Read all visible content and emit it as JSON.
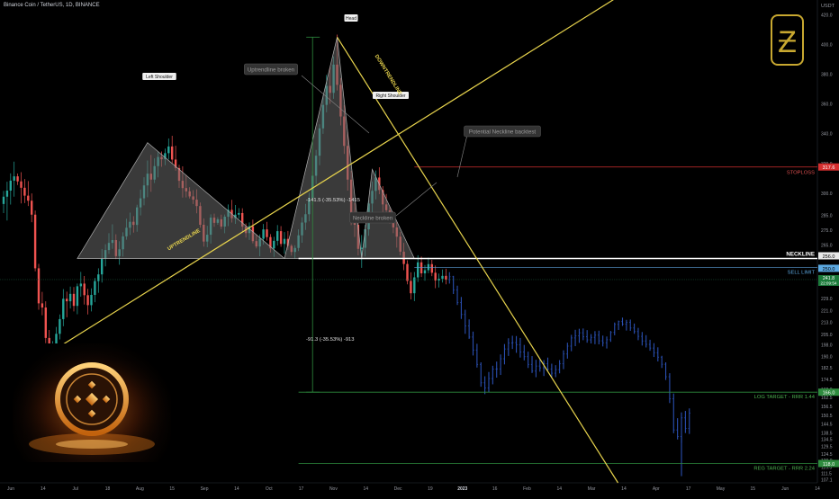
{
  "header": {
    "symbol_title": "Binance Coin / TetherUS, 1D, BINANCE"
  },
  "colors": {
    "up": "#26a69a",
    "down": "#ef5350",
    "projection": "#2a4fb0",
    "pattern_line": "#e8d44d",
    "green_line": "#2e8b3e",
    "stop_line": "#d32f2f",
    "neckline": "#ffffff",
    "shape_fill": "#6a6a6a",
    "label_bg": "#333333",
    "label_fg": "#9a9a9a",
    "logo": "#c8a830"
  },
  "logo": {
    "letter": "Ƶ",
    "icon": "stylized-b-logo-icon"
  },
  "photo": {
    "icon": "bnb-coin-icon"
  },
  "labels": {
    "head": "Head",
    "left_shoulder": "Left Shoulder",
    "right_shoulder": "Right Shoulder",
    "uptrend_broken": "Uptrendline broken",
    "potential_backtest": "Potential Neckline backtest",
    "neckline_broken": "Neckline broken",
    "uptrendline": "UPTRENDLINE",
    "downtrendline": "DOWNTRENDLINE",
    "neckline": "NECKLINE",
    "stoploss": "STOPLOSS",
    "sell_limit": "SELL LIMIT",
    "log_target": "LOG TARGET - RRR 1.44",
    "reg_target": "REG TARGET - RRR 2.24",
    "measure_top": "-141.5 (-35.53%) -1415",
    "measure_bottom": "-91.3 (-35.53%) -913"
  },
  "price_tags": {
    "stop": "317.6",
    "neck_top": "256.0",
    "neck_bottom": "250.0",
    "current": "241.8",
    "countdown": "22:09:54",
    "log": "166.0",
    "reg": "118.0"
  },
  "chart_data": {
    "type": "candlestick",
    "y_unit": "USDT",
    "ylim": [
      105,
      430
    ],
    "x_tick_labels": [
      "Jun",
      "14",
      "Jul",
      "18",
      "Aug",
      "15",
      "Sep",
      "14",
      "Oct",
      "17",
      "Nov",
      "14",
      "Dec",
      "19",
      "2023",
      "16",
      "Feb",
      "14",
      "Mar",
      "14",
      "Apr",
      "17",
      "May",
      "15",
      "Jun",
      "14"
    ],
    "y_tick_labels": [
      "420.0",
      "400.0",
      "380.0",
      "360.0",
      "340.0",
      "320.0",
      "300.0",
      "285.0",
      "275.0",
      "265.0",
      "250.0",
      "240.0",
      "229.0",
      "221.0",
      "213.0",
      "205.0",
      "198.0",
      "190.0",
      "182.5",
      "174.5",
      "168.0",
      "162.5",
      "156.5",
      "150.5",
      "144.5",
      "138.5",
      "134.5",
      "129.5",
      "124.5",
      "120.0",
      "115.5",
      "111.5",
      "107.1"
    ],
    "levels": {
      "stoploss": 317.6,
      "neckline": 256.0,
      "neckline_lower": 250.0,
      "current_price": 241.8,
      "log_target": 166.0,
      "reg_target": 118.0,
      "head": 405.0
    },
    "pattern": {
      "left_shoulder": {
        "start": [
          21,
          256
        ],
        "peak": [
          41,
          334
        ],
        "end": [
          80,
          256
        ]
      },
      "head": {
        "start": [
          80,
          256
        ],
        "peak": [
          95,
          405
        ],
        "end": [
          102,
          256
        ]
      },
      "right_shoulder": {
        "start": [
          102,
          256
        ],
        "peak": [
          105,
          316
        ],
        "end": [
          117,
          256
        ]
      }
    },
    "trendlines": {
      "uptrend": {
        "from": [
          7,
          183.5
        ],
        "to": [
          183,
          444
        ]
      },
      "downtrend": {
        "from": [
          95,
          405
        ],
        "to": [
          175,
          105
        ]
      }
    },
    "measure": {
      "x": 88,
      "top": [
        405,
        256
      ],
      "bottom": [
        256,
        166
      ]
    },
    "candles_history": [
      [
        292.7,
        301.5,
        286.6,
        297.6
      ],
      [
        297.6,
        307.7,
        281.6,
        301.7
      ],
      [
        301.7,
        313.3,
        292.3,
        308.4
      ],
      [
        308.4,
        321.2,
        297.6,
        311.3
      ],
      [
        311.3,
        313.2,
        305.5,
        307.9
      ],
      [
        307.9,
        314.1,
        293.1,
        303.6
      ],
      [
        303.6,
        309.5,
        293.3,
        298.3
      ],
      [
        298.3,
        308.1,
        291.3,
        294.9
      ],
      [
        294.9,
        299.8,
        280.4,
        285.5
      ],
      [
        285.5,
        288.3,
        247.4,
        249.4
      ],
      [
        249.4,
        252.4,
        221.5,
        225.8
      ],
      [
        225.8,
        233.5,
        217.8,
        223.0
      ],
      [
        223.0,
        227.2,
        199.0,
        202.5
      ],
      [
        202.5,
        207.9,
        180.7,
        186.5
      ],
      [
        186.5,
        200.4,
        183.8,
        193.9
      ],
      [
        193.9,
        209.9,
        190.2,
        205.3
      ],
      [
        205.3,
        218.3,
        201.5,
        215.2
      ],
      [
        215.2,
        235.4,
        210.4,
        228.9
      ],
      [
        228.9,
        233.7,
        216.4,
        227.2
      ],
      [
        227.2,
        237.1,
        222.3,
        232.2
      ],
      [
        232.2,
        236.8,
        220.4,
        224.1
      ],
      [
        224.1,
        239.1,
        218.5,
        237.3
      ],
      [
        237.3,
        247.0,
        230.3,
        239.1
      ],
      [
        239.1,
        244.2,
        225.0,
        231.3
      ],
      [
        231.3,
        235.6,
        218.3,
        224.6
      ],
      [
        224.6,
        235.9,
        220.4,
        231.5
      ],
      [
        231.5,
        242.9,
        226.6,
        240.8
      ],
      [
        240.8,
        249.4,
        232.9,
        245.3
      ],
      [
        245.3,
        262.4,
        239.8,
        255.9
      ],
      [
        255.9,
        265.6,
        250.7,
        261.7
      ],
      [
        261.7,
        273.0,
        259.1,
        266.5
      ],
      [
        266.5,
        279.0,
        262.5,
        268.4
      ],
      [
        268.4,
        272.3,
        255.6,
        257.6
      ],
      [
        257.6,
        267.6,
        251.8,
        262.2
      ],
      [
        262.2,
        273.6,
        257.4,
        270.9
      ],
      [
        270.9,
        282.8,
        268.6,
        276.7
      ],
      [
        276.7,
        286.9,
        271.8,
        280.7
      ],
      [
        280.7,
        284.5,
        273.4,
        278.6
      ],
      [
        278.6,
        292.2,
        274.0,
        290.4
      ],
      [
        290.4,
        302.4,
        285.0,
        296.5
      ],
      [
        296.5,
        310.7,
        291.8,
        305.2
      ],
      [
        305.2,
        322.0,
        297.2,
        313.1
      ],
      [
        313.1,
        325.7,
        300.9,
        309.1
      ],
      [
        309.1,
        323.4,
        306.8,
        318.2
      ],
      [
        318.2,
        327.6,
        310.6,
        324.3
      ],
      [
        324.3,
        328.0,
        317.7,
        322.8
      ],
      [
        322.8,
        330.0,
        318.8,
        326.9
      ],
      [
        326.9,
        336.8,
        322.7,
        331.4
      ],
      [
        331.4,
        338.6,
        319.6,
        322.6
      ],
      [
        322.6,
        331.9,
        315.1,
        316.9
      ],
      [
        316.9,
        319.1,
        303.5,
        308.3
      ],
      [
        308.3,
        318.0,
        297.0,
        303.4
      ],
      [
        303.4,
        312.2,
        297.1,
        301.2
      ],
      [
        301.2,
        304.0,
        296.4,
        297.8
      ],
      [
        297.8,
        302.0,
        292.7,
        295.6
      ],
      [
        295.6,
        302.5,
        286.4,
        291.3
      ],
      [
        291.3,
        293.7,
        276.7,
        278.7
      ],
      [
        278.7,
        283.0,
        264.0,
        267.4
      ],
      [
        267.4,
        278.0,
        263.6,
        272.0
      ],
      [
        272.0,
        285.7,
        266.1,
        283.5
      ],
      [
        283.5,
        286.2,
        277.3,
        280.0
      ],
      [
        280.0,
        283.8,
        278.7,
        282.4
      ],
      [
        282.4,
        285.5,
        275.8,
        277.5
      ],
      [
        277.5,
        285.6,
        273.0,
        284.1
      ],
      [
        284.1,
        292.4,
        277.8,
        288.7
      ],
      [
        288.7,
        295.5,
        280.2,
        283.1
      ],
      [
        283.1,
        292.0,
        279.3,
        285.5
      ],
      [
        285.5,
        289.9,
        282.8,
        286.6
      ],
      [
        286.6,
        289.8,
        273.4,
        277.5
      ],
      [
        277.5,
        279.6,
        270.1,
        273.1
      ],
      [
        273.1,
        280.3,
        268.5,
        277.7
      ],
      [
        277.7,
        282.2,
        266.2,
        267.7
      ],
      [
        267.7,
        272.1,
        262.8,
        264.1
      ],
      [
        264.1,
        272.2,
        257.5,
        269.3
      ],
      [
        269.3,
        279.2,
        265.4,
        275.6
      ],
      [
        275.6,
        280.7,
        268.0,
        270.4
      ],
      [
        270.4,
        272.4,
        260.0,
        262.8
      ],
      [
        262.8,
        270.6,
        257.1,
        267.9
      ],
      [
        267.9,
        278.5,
        264.7,
        274.4
      ],
      [
        274.4,
        277.8,
        263.9,
        265.8
      ],
      [
        265.8,
        273.8,
        259.2,
        269.2
      ],
      [
        269.2,
        274.5,
        261.9,
        264.5
      ],
      [
        264.5,
        265.6,
        258.0,
        260.4
      ],
      [
        260.4,
        264.9,
        255.8,
        263.1
      ],
      [
        263.1,
        275.6,
        261.0,
        271.6
      ],
      [
        271.6,
        283.8,
        266.6,
        280.2
      ],
      [
        280.2,
        292.8,
        275.2,
        285.8
      ],
      [
        285.8,
        300.3,
        281.0,
        296.7
      ],
      [
        296.7,
        314.8,
        291.9,
        311.7
      ],
      [
        311.7,
        329.1,
        306.2,
        325.2
      ],
      [
        325.2,
        346.3,
        318.8,
        343.6
      ],
      [
        343.6,
        365.8,
        339.9,
        359.4
      ],
      [
        359.4,
        379.6,
        354.4,
        372.2
      ],
      [
        372.2,
        384.8,
        360.1,
        367.5
      ],
      [
        367.5,
        392.0,
        363.5,
        386.5
      ],
      [
        386.5,
        406.7,
        369.1,
        372.9
      ],
      [
        372.9,
        377.4,
        345.6,
        351.6
      ],
      [
        351.6,
        359.1,
        326.4,
        331.8
      ],
      [
        331.8,
        341.1,
        301.7,
        309.1
      ],
      [
        309.1,
        315.0,
        278.5,
        285.3
      ],
      [
        285.3,
        293.3,
        270.5,
        278.7
      ],
      [
        278.7,
        285.4,
        258.1,
        262.5
      ],
      [
        262.5,
        271.8,
        249.7,
        263.2
      ],
      [
        263.2,
        278.6,
        257.4,
        275.6
      ],
      [
        275.6,
        295.1,
        271.3,
        293.0
      ],
      [
        293.0,
        307.8,
        285.4,
        301.5
      ],
      [
        301.5,
        315.2,
        295.8,
        310.5
      ],
      [
        310.5,
        317.4,
        299.3,
        302.1
      ],
      [
        302.1,
        304.7,
        287.3,
        292.4
      ],
      [
        292.4,
        299.4,
        285.4,
        288.5
      ],
      [
        288.5,
        290.6,
        279.5,
        283.4
      ],
      [
        283.4,
        287.5,
        273.1,
        276.9
      ],
      [
        276.9,
        280.8,
        263.3,
        270.7
      ],
      [
        270.7,
        273.9,
        258.1,
        260.6
      ],
      [
        260.6,
        266.5,
        248.1,
        252.3
      ],
      [
        252.3,
        254.8,
        238.6,
        240.9
      ],
      [
        240.9,
        246.7,
        228.5,
        232.6
      ],
      [
        232.6,
        246.9,
        227.3,
        243.3
      ],
      [
        243.3,
        258.2,
        240.2,
        253.4
      ],
      [
        253.4,
        257.3,
        243.5,
        246.0
      ],
      [
        246.0,
        251.6,
        241.0,
        248.1
      ],
      [
        248.1,
        256.6,
        246.1,
        252.2
      ],
      [
        252.2,
        255.1,
        244.1,
        246.4
      ],
      [
        246.4,
        251.3,
        236.0,
        241.2
      ],
      [
        241.2,
        245.9,
        236.5,
        242.4
      ],
      [
        242.4,
        248.6,
        239.8,
        244.3
      ],
      [
        244.3,
        249.1,
        238.6,
        241.8
      ]
    ],
    "projection": [
      [
        241.8,
        246.8,
        239.1,
        243.7
      ],
      [
        243.7,
        244.3,
        232.1,
        234.8
      ],
      [
        234.8,
        237.7,
        224.7,
        226.3
      ],
      [
        226.3,
        230.1,
        215.3,
        218.3
      ],
      [
        218.3,
        221.5,
        205.3,
        210.6
      ],
      [
        210.6,
        215.0,
        201.9,
        203.1
      ],
      [
        203.1,
        206.8,
        190.7,
        194.4
      ],
      [
        194.4,
        198.6,
        182.6,
        184.7
      ],
      [
        184.7,
        186.1,
        169.7,
        172.3
      ],
      [
        172.3,
        176.7,
        164.7,
        168.9
      ],
      [
        168.9,
        179.6,
        165.8,
        175.2
      ],
      [
        175.2,
        183.8,
        171.3,
        181.5
      ],
      [
        181.5,
        186.6,
        175.8,
        181.7
      ],
      [
        181.7,
        191.4,
        177.6,
        188.5
      ],
      [
        188.5,
        198.4,
        184.7,
        195.1
      ],
      [
        195.1,
        202.3,
        190.4,
        199.2
      ],
      [
        199.2,
        204.0,
        195.1,
        199.4
      ],
      [
        199.4,
        203.8,
        192.5,
        198.0
      ],
      [
        198.0,
        202.5,
        189.3,
        193.1
      ],
      [
        193.1,
        197.8,
        187.4,
        189.9
      ],
      [
        189.9,
        193.3,
        182.3,
        184.7
      ],
      [
        184.7,
        190.3,
        178.9,
        180.2
      ],
      [
        180.2,
        187.8,
        176.1,
        183.6
      ],
      [
        183.6,
        188.0,
        179.8,
        182.4
      ],
      [
        182.4,
        187.6,
        176.9,
        185.1
      ],
      [
        185.1,
        189.3,
        180.3,
        181.6
      ],
      [
        181.6,
        185.2,
        175.6,
        178.8
      ],
      [
        178.8,
        184.2,
        176.1,
        181.2
      ],
      [
        181.2,
        187.6,
        178.7,
        185.1
      ],
      [
        185.1,
        194.2,
        181.5,
        191.7
      ],
      [
        191.7,
        199.3,
        188.6,
        197.0
      ],
      [
        197.0,
        204.6,
        193.6,
        202.5
      ],
      [
        202.5,
        208.0,
        197.0,
        204.0
      ],
      [
        204.0,
        208.7,
        199.2,
        206.0
      ],
      [
        206.0,
        208.9,
        201.0,
        203.3
      ],
      [
        203.3,
        207.8,
        199.3,
        201.2
      ],
      [
        201.2,
        205.1,
        198.8,
        202.9
      ],
      [
        202.9,
        207.1,
        198.3,
        204.4
      ],
      [
        204.4,
        207.4,
        198.2,
        200.6
      ],
      [
        200.6,
        204.1,
        196.8,
        199.3
      ],
      [
        199.3,
        203.5,
        195.4,
        201.3
      ],
      [
        201.3,
        207.2,
        199.9,
        206.2
      ],
      [
        206.2,
        212.9,
        204.3,
        211.6
      ],
      [
        211.6,
        214.2,
        207.9,
        213.5
      ],
      [
        213.5,
        216.2,
        210.6,
        211.9
      ],
      [
        211.9,
        214.7,
        207.5,
        213.1
      ],
      [
        213.1,
        214.9,
        207.3,
        209.2
      ],
      [
        209.2,
        212.2,
        205.3,
        206.8
      ],
      [
        206.8,
        209.3,
        201.0,
        203.6
      ],
      [
        203.6,
        206.5,
        197.4,
        200.5
      ],
      [
        200.5,
        204.4,
        196.1,
        198.2
      ],
      [
        198.2,
        201.3,
        193.9,
        195.7
      ],
      [
        195.7,
        199.0,
        189.7,
        192.6
      ],
      [
        192.6,
        196.2,
        186.7,
        189.6
      ],
      [
        189.6,
        190.5,
        182.3,
        184.8
      ],
      [
        184.8,
        186.1,
        174.2,
        176.4
      ],
      [
        176.4,
        178.8,
        158.7,
        161.5
      ],
      [
        161.5,
        165.1,
        138.4,
        140.6
      ],
      [
        140.6,
        148.5,
        134.2,
        136.1
      ],
      [
        136.1,
        152.4,
        131.8,
        148.7
      ],
      [
        148.7,
        153.4,
        138.5,
        141.6
      ],
      [
        141.6,
        155.1,
        137.9,
        152.0
      ]
    ],
    "projection_wick_low": 109.5
  }
}
